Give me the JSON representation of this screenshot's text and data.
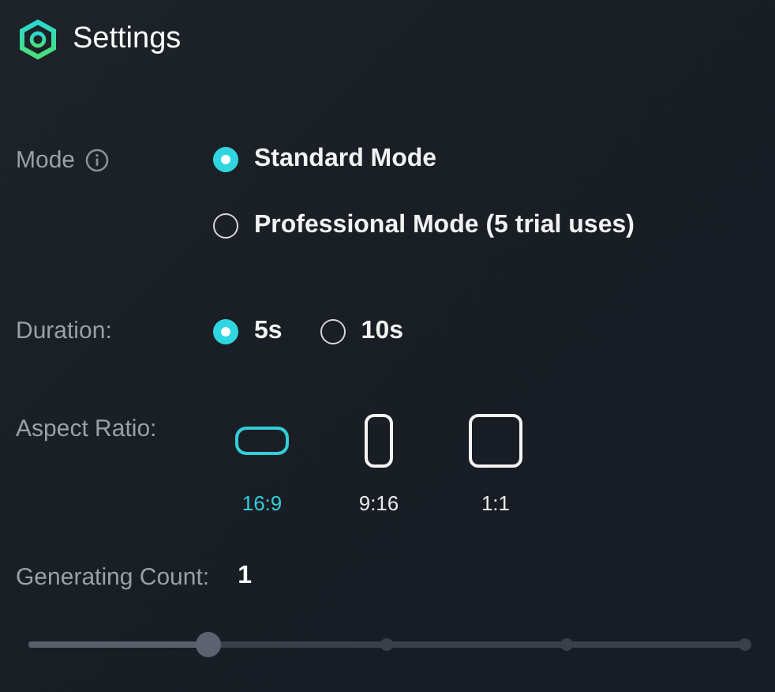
{
  "header": {
    "title": "Settings"
  },
  "mode": {
    "label": "Mode",
    "options": [
      {
        "label": "Standard Mode",
        "selected": true
      },
      {
        "label": "Professional Mode (5 trial uses)",
        "selected": false
      }
    ]
  },
  "duration": {
    "label": "Duration:",
    "options": [
      {
        "label": "5s",
        "selected": true
      },
      {
        "label": "10s",
        "selected": false
      }
    ]
  },
  "aspect_ratio": {
    "label": "Aspect Ratio:",
    "options": [
      {
        "label": "16:9",
        "kind": "wide",
        "selected": true
      },
      {
        "label": "9:16",
        "kind": "tall",
        "selected": false
      },
      {
        "label": "1:1",
        "kind": "square",
        "selected": false
      }
    ]
  },
  "generating_count": {
    "label": "Generating Count:",
    "value": "1",
    "level": 0.25
  }
}
